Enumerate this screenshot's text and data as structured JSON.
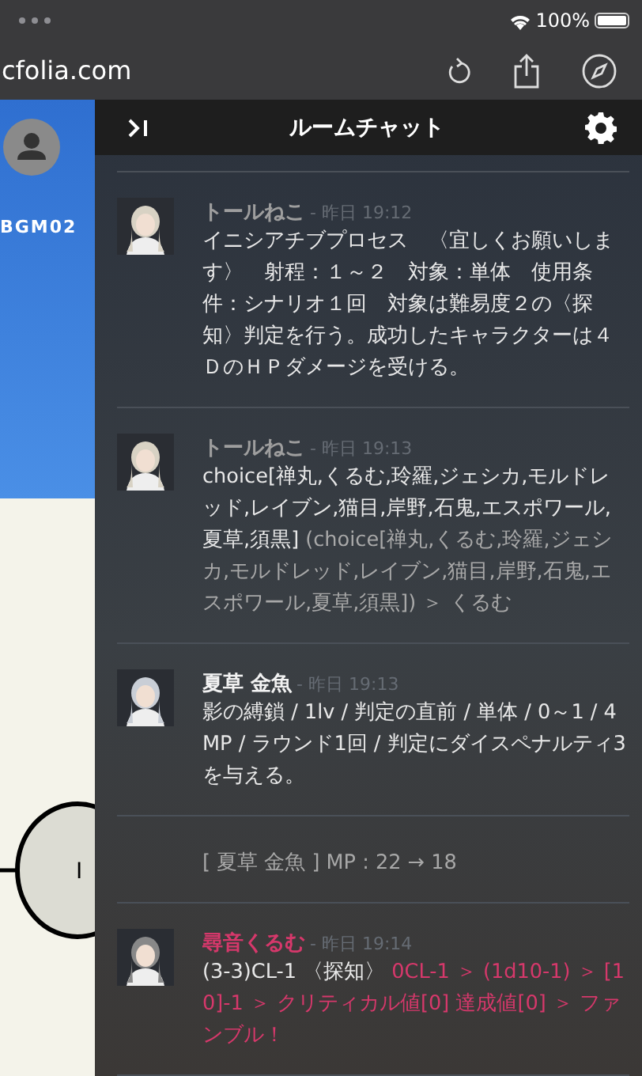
{
  "status_bar": {
    "battery": "100%"
  },
  "browser": {
    "url": "cfolia.com"
  },
  "board": {
    "bgm_label": "BGM02",
    "token_label": "I"
  },
  "chat": {
    "title": "ルームチャット",
    "messages": [
      {
        "kind": "message",
        "name": "トールねこ",
        "color": "#9e9e9e",
        "time": "- 昨日 19:12",
        "body": [
          {
            "text": "イニシアチブプロセス　〈宜しくお願いします〉　射程：１～２　対象：単体　使用条件：シナリオ１回　対象は難易度２の〈探知〉判定を行う。成功したキャラクターは４ＤのＨＰダメージを受ける。",
            "color": "#e8e8e8"
          }
        ]
      },
      {
        "kind": "message",
        "name": "トールねこ",
        "color": "#9e9e9e",
        "time": "- 昨日 19:13",
        "body": [
          {
            "text": "choice[禅丸,くるむ,玲羅,ジェシカ,モルドレッド,レイブン,猫目,岸野,石鬼,エスポワール,夏草,須黒] ",
            "color": "#e8e8e8"
          },
          {
            "text": " (choice[禅丸,くるむ,玲羅,ジェシカ,モルドレッド,レイブン,猫目,岸野,石鬼,エスポワール,夏草,須黒]) ＞ くるむ",
            "color": "#a8a8a8"
          }
        ]
      },
      {
        "kind": "message",
        "name": "夏草 金魚",
        "color": "#f2f2f2",
        "time": "- 昨日 19:13",
        "body": [
          {
            "text": "影の縛鎖 / 1lv / 判定の直前 / 単体 / 0～1 / 4MP / ラウンド1回 / 判定にダイスペナルティ3を与える。",
            "color": "#e8e8e8"
          }
        ]
      },
      {
        "kind": "system",
        "body": [
          {
            "text": "[ 夏草 金魚 ] MP : 22 → 18",
            "color": "#a8a8a8"
          }
        ]
      },
      {
        "kind": "message",
        "name": "尋音くるむ",
        "color": "#d6386b",
        "time": "- 昨日 19:14",
        "body": [
          {
            "text": "(3-3)CL-1 〈探知〉 ",
            "color": "#e8e8e8"
          },
          {
            "text": "0CL-1 ＞ (1d10-1) ＞ [10]-1 ＞ クリティカル値[0] 達成値[0] ＞ ファンブル！",
            "color": "#d6386b"
          }
        ]
      }
    ]
  }
}
